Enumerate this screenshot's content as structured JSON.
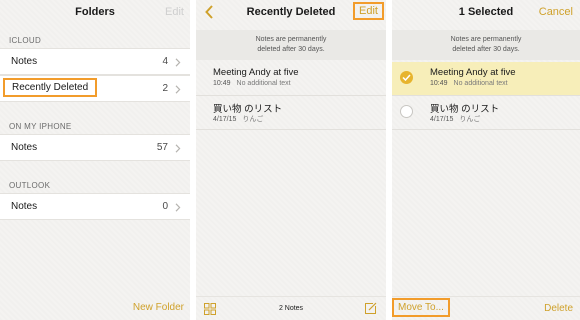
{
  "accent_color": "#cfa12b",
  "highlight_color": "#f29c2b",
  "selected_row_color": "#f7eeb9",
  "panel1": {
    "title": "Folders",
    "edit_label": "Edit",
    "sections": [
      {
        "header": "ICLOUD",
        "rows": [
          {
            "label": "Notes",
            "count": "4"
          },
          {
            "label": "Recently Deleted",
            "count": "2"
          }
        ]
      },
      {
        "header": "ON MY IPHONE",
        "rows": [
          {
            "label": "Notes",
            "count": "57"
          }
        ]
      },
      {
        "header": "OUTLOOK",
        "rows": [
          {
            "label": "Notes",
            "count": "0"
          }
        ]
      }
    ],
    "new_folder_label": "New Folder"
  },
  "panel2": {
    "back_icon": "chevron-left-icon",
    "title": "Recently Deleted",
    "edit_label": "Edit",
    "banner_line1": "Notes are permanently",
    "banner_line2": "deleted after 30 days.",
    "notes": [
      {
        "title": "Meeting Andy at five",
        "time": "10:49",
        "preview": "No additional text"
      },
      {
        "title": "買い物 のリスト",
        "time": "4/17/15",
        "preview": "りんご"
      }
    ],
    "note_count": "2 Notes",
    "grid_icon": "grid-icon",
    "compose_icon": "compose-icon"
  },
  "panel3": {
    "title": "1 Selected",
    "cancel_label": "Cancel",
    "banner_line1": "Notes are permanently",
    "banner_line2": "deleted after 30 days.",
    "notes": [
      {
        "title": "Meeting Andy at five",
        "time": "10:49",
        "preview": "No additional text",
        "selected": true
      },
      {
        "title": "買い物 のリスト",
        "time": "4/17/15",
        "preview": "りんご",
        "selected": false
      }
    ],
    "move_to_label": "Move To...",
    "delete_label": "Delete"
  }
}
